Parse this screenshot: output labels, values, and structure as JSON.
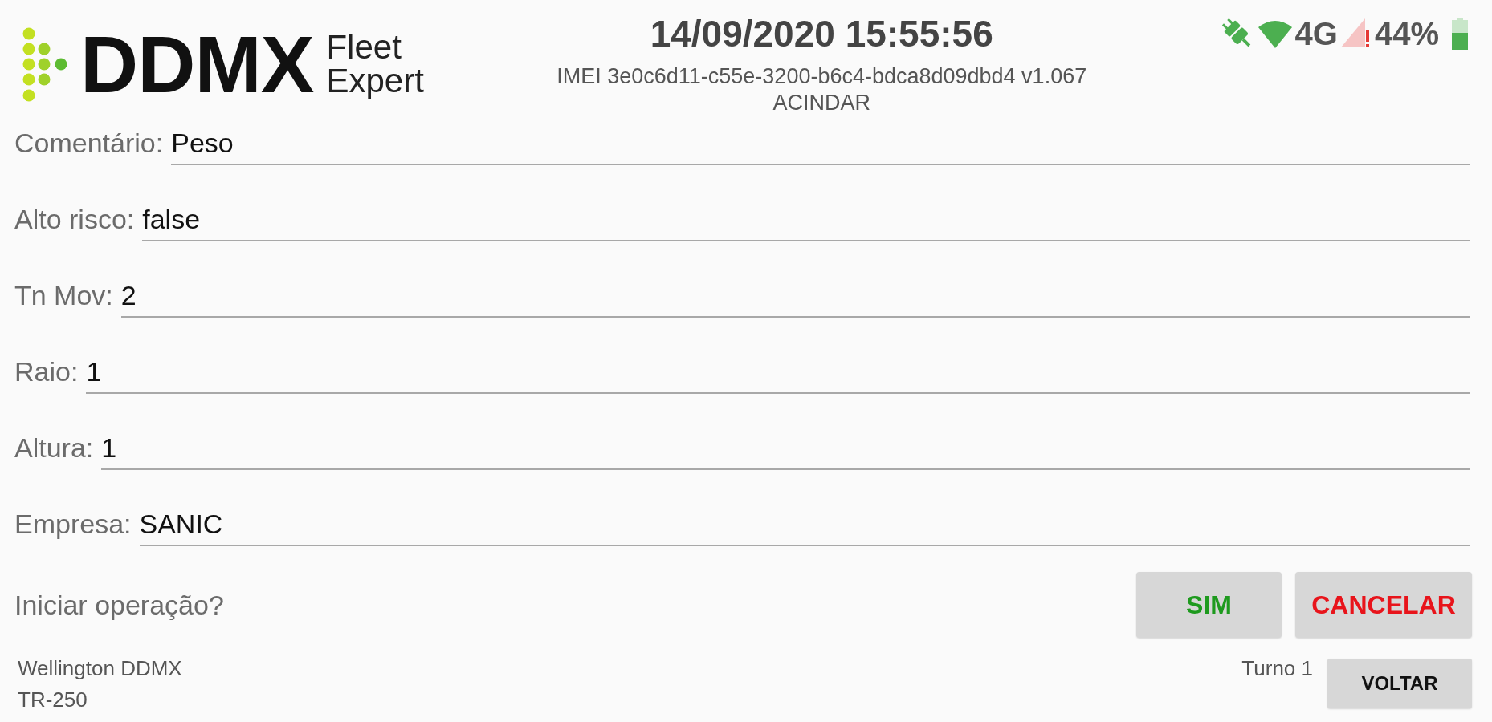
{
  "logo": {
    "brand": "DDMX",
    "tagline": [
      "Fleet",
      "Expert"
    ]
  },
  "header": {
    "datetime": "14/09/2020 15:55:56",
    "device": "IMEI 3e0c6d11-c55e-3200-b6c4-bdca8d09dbd4 v1.067",
    "company": "ACINDAR"
  },
  "status_bar": {
    "network": "4G",
    "battery": "44%"
  },
  "fields": [
    {
      "label": "Comentário:",
      "value": "Peso"
    },
    {
      "label": "Alto risco:",
      "value": "false"
    },
    {
      "label": "Tn Mov:",
      "value": "2"
    },
    {
      "label": "Raio:",
      "value": "1"
    },
    {
      "label": "Altura:",
      "value": "1"
    },
    {
      "label": "Empresa:",
      "value": "SANIC"
    }
  ],
  "question": "Iniciar operação?",
  "actions": [
    {
      "label": "SIM",
      "kind": "confirm"
    },
    {
      "label": "CANCELAR",
      "kind": "cancel"
    }
  ],
  "footer": {
    "user": "Wellington DDMX",
    "vehicle": "TR-250",
    "shift": "Turno 1",
    "back_button": "VOLTAR"
  }
}
